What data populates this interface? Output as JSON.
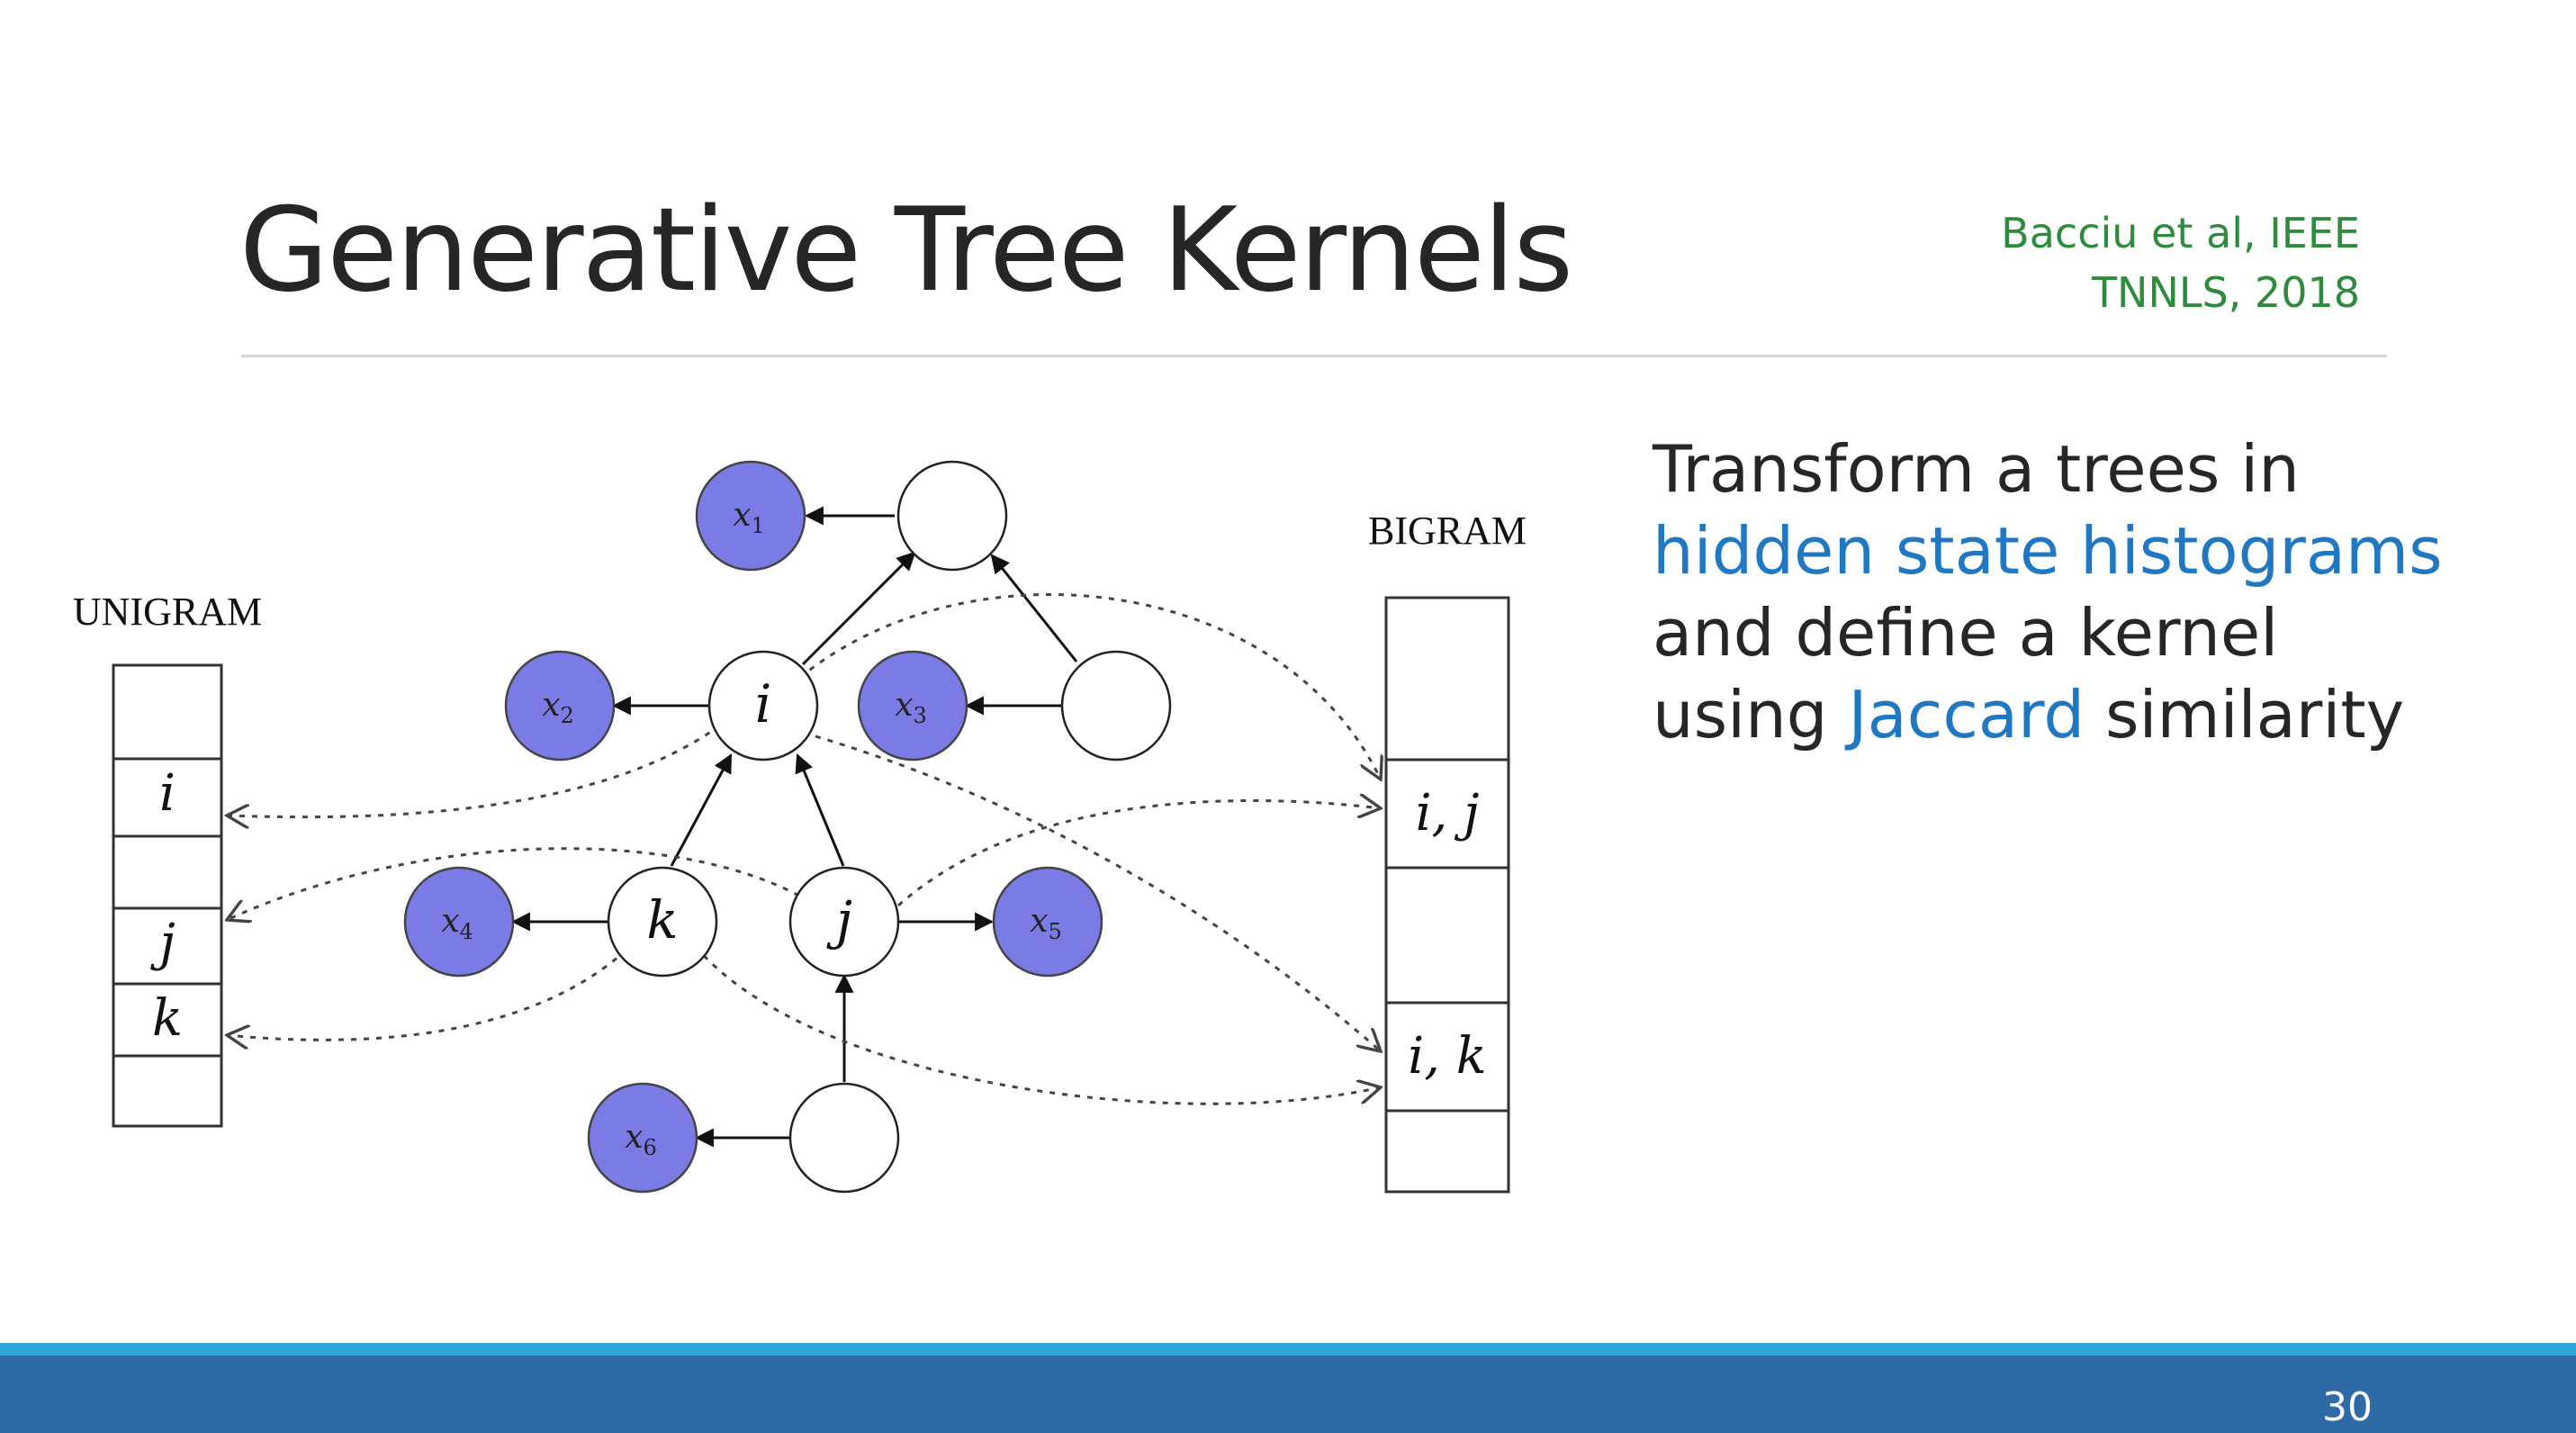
{
  "slide": {
    "title": "Generative Tree Kernels",
    "citation_line1": "Bacciu et al, IEEE",
    "citation_line2": "TNNLS, 2018",
    "body_line1": "Transform a trees in",
    "body_line2": "hidden state histograms",
    "body_line3_a": "and define a kernel",
    "body_line4_a": "using ",
    "body_line4_b": "Jaccard",
    "body_line4_c": " similarity",
    "page_number": "30"
  },
  "diagram": {
    "unigram_heading": "UNIGRAM",
    "bigram_heading": "BIGRAM",
    "unigram_cells": [
      "",
      "i",
      "",
      "j",
      "k",
      ""
    ],
    "bigram_cells": [
      "",
      "i, j",
      "",
      "i, k",
      ""
    ],
    "hidden_nodes": [
      "",
      "i",
      "",
      "k",
      "j",
      ""
    ],
    "observed_nodes": {
      "x1_base": "x",
      "x1_sub": "1",
      "x2_base": "x",
      "x2_sub": "2",
      "x3_base": "x",
      "x3_sub": "3",
      "x4_base": "x",
      "x4_sub": "4",
      "x5_base": "x",
      "x5_sub": "5",
      "x6_base": "x",
      "x6_sub": "6"
    }
  },
  "colors": {
    "observed_fill": "#7b7be6",
    "accent_blue": "#1f78c1",
    "citation_green": "#2e8b3e",
    "footer_blue": "#2d6aa6",
    "footer_stripe": "#2ea8d8"
  }
}
